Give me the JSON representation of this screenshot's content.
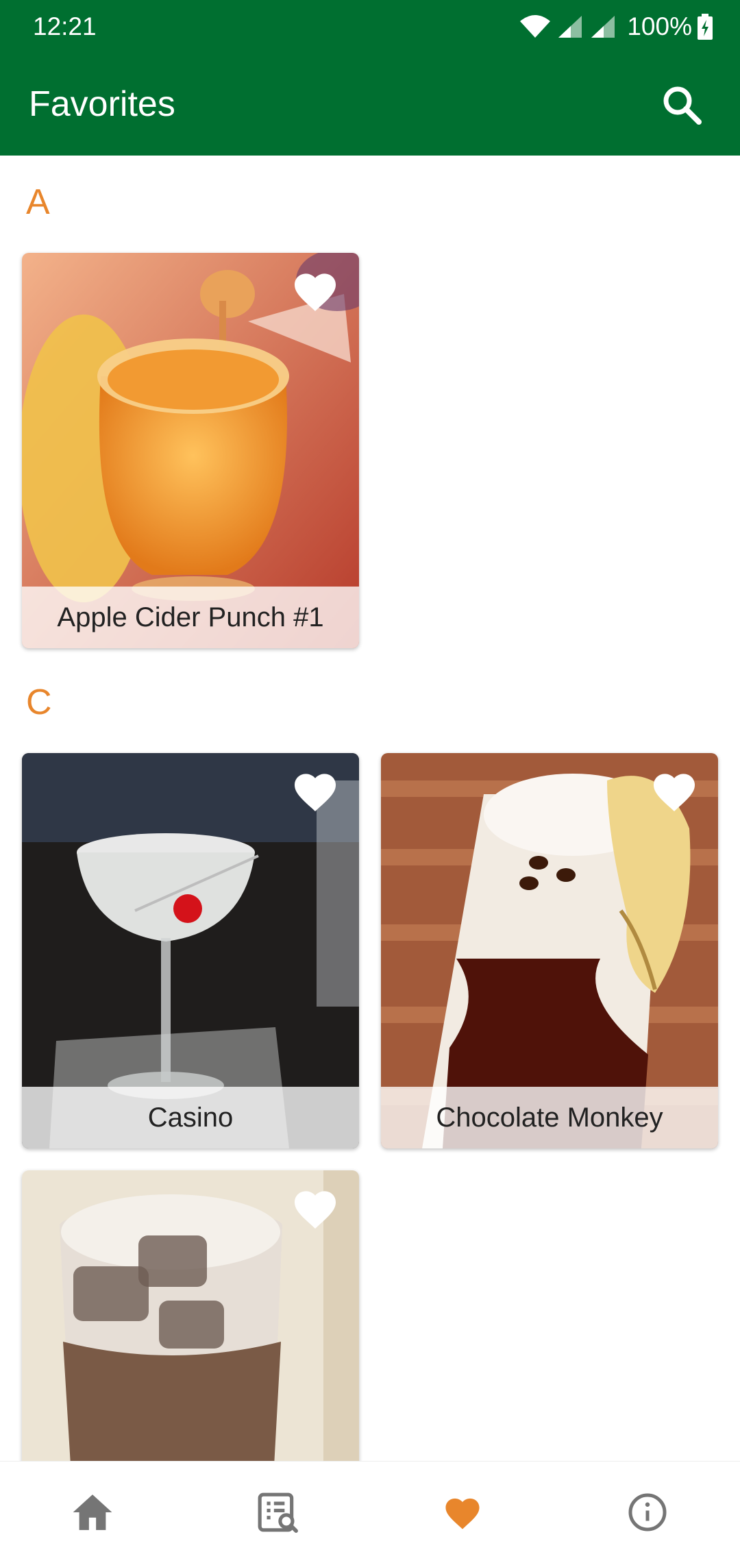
{
  "status_bar": {
    "time": "12:21",
    "battery": "100%",
    "icons": [
      "wifi-icon",
      "cell-signal-icon",
      "cell-signal-icon",
      "battery-charging-icon"
    ]
  },
  "app_bar": {
    "title": "Favorites",
    "search_icon": "search-icon"
  },
  "colors": {
    "primary": "#006F30",
    "accent": "#E8862C",
    "nav_inactive": "#757575"
  },
  "sections": [
    {
      "letter": "A",
      "items": [
        {
          "name": "Apple Cider Punch #1",
          "favorited": true
        }
      ]
    },
    {
      "letter": "C",
      "items": [
        {
          "name": "Casino",
          "favorited": true
        },
        {
          "name": "Chocolate Monkey",
          "favorited": true
        },
        {
          "name": "",
          "favorited": true
        }
      ]
    }
  ],
  "bottom_nav": {
    "items": [
      {
        "icon": "home-icon",
        "active": false
      },
      {
        "icon": "list-search-icon",
        "active": false
      },
      {
        "icon": "heart-icon",
        "active": true
      },
      {
        "icon": "info-icon",
        "active": false
      }
    ]
  }
}
